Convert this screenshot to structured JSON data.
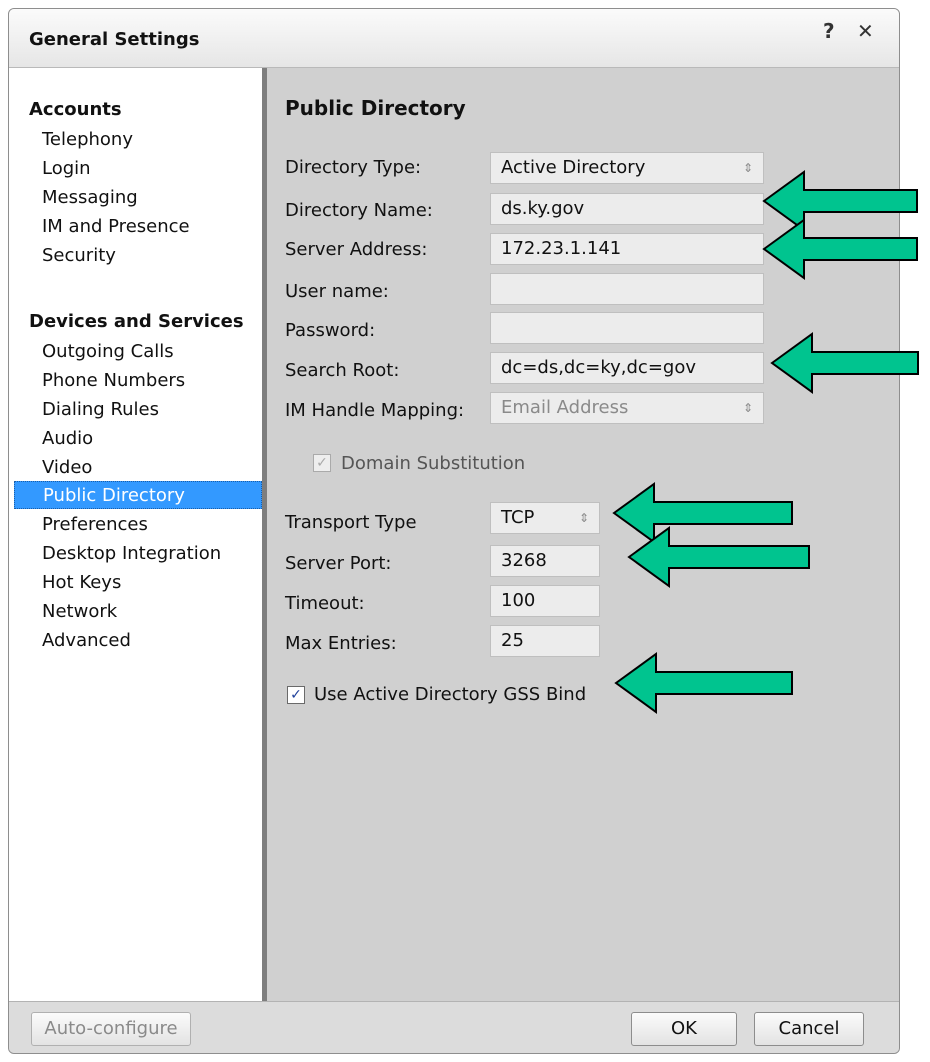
{
  "window": {
    "title": "General Settings",
    "help_icon": "?",
    "close_icon": "✕"
  },
  "sidebar": {
    "accounts_header": "Accounts",
    "accounts_items": [
      {
        "label": "Telephony"
      },
      {
        "label": "Login"
      },
      {
        "label": "Messaging"
      },
      {
        "label": "IM and Presence"
      },
      {
        "label": "Security"
      }
    ],
    "devices_header": "Devices and Services",
    "devices_items": [
      {
        "label": "Outgoing Calls"
      },
      {
        "label": "Phone Numbers"
      },
      {
        "label": "Dialing Rules"
      },
      {
        "label": "Audio"
      },
      {
        "label": "Video"
      },
      {
        "label": "Public Directory"
      },
      {
        "label": "Preferences"
      },
      {
        "label": "Desktop Integration"
      },
      {
        "label": "Hot Keys"
      },
      {
        "label": "Network"
      },
      {
        "label": "Advanced"
      }
    ],
    "selected": "Public Directory"
  },
  "main": {
    "title": "Public Directory",
    "directory_type": {
      "label": "Directory Type:",
      "value": "Active Directory"
    },
    "directory_name": {
      "label": "Directory Name:",
      "value": "ds.ky.gov"
    },
    "server_address": {
      "label": "Server Address:",
      "value": "172.23.1.141"
    },
    "user_name": {
      "label": "User name:",
      "value": ""
    },
    "password": {
      "label": "Password:",
      "value": ""
    },
    "search_root": {
      "label": "Search Root:",
      "value": "dc=ds,dc=ky,dc=gov"
    },
    "im_handle_mapping": {
      "label": "IM Handle Mapping:",
      "value": "Email Address"
    },
    "domain_substitution": {
      "label": "Domain Substitution",
      "checked": true,
      "enabled": false
    },
    "transport_type": {
      "label": "Transport Type",
      "value": "TCP"
    },
    "server_port": {
      "label": "Server Port:",
      "value": "3268"
    },
    "timeout": {
      "label": "Timeout:",
      "value": "100"
    },
    "max_entries": {
      "label": "Max Entries:",
      "value": "25"
    },
    "gss_bind": {
      "label": "Use Active Directory GSS Bind",
      "checked": true
    }
  },
  "footer": {
    "auto_configure": "Auto-configure",
    "ok": "OK",
    "cancel": "Cancel"
  },
  "colors": {
    "selection": "#3399ff",
    "annotation_arrow": "#00c48f",
    "panel": "#d0d0d0"
  },
  "icons": {
    "check": "✓",
    "select_arrows": "⇕"
  }
}
